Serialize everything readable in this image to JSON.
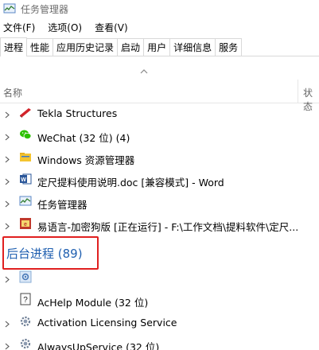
{
  "window": {
    "title": "任务管理器",
    "app_icon": "task-manager-icon"
  },
  "menu": [
    {
      "label": "文件(F)"
    },
    {
      "label": "选项(O)"
    },
    {
      "label": "查看(V)"
    }
  ],
  "tabs": [
    {
      "label": "进程",
      "active": true
    },
    {
      "label": "性能"
    },
    {
      "label": "应用历史记录"
    },
    {
      "label": "启动"
    },
    {
      "label": "用户"
    },
    {
      "label": "详细信息"
    },
    {
      "label": "服务"
    }
  ],
  "columns": {
    "name": "名称",
    "status": "状态"
  },
  "apps": [
    {
      "label": "Tekla Structures",
      "icon": "tekla-icon"
    },
    {
      "label": "WeChat (32 位) (4)",
      "icon": "wechat-icon"
    },
    {
      "label": "Windows 资源管理器",
      "icon": "folder-icon"
    },
    {
      "label": "定尺提料使用说明.doc [兼容模式] - Word",
      "icon": "word-icon"
    },
    {
      "label": "任务管理器",
      "icon": "task-manager-icon"
    },
    {
      "label": "易语言-加密狗版 [正在运行] - F:\\工作文档\\提料软件\\定尺...",
      "icon": "e-language-icon"
    }
  ],
  "background_section": {
    "title": "后台进程 (89)"
  },
  "background": [
    {
      "label": "",
      "icon": "gear-icon",
      "has_chevron": true
    },
    {
      "label": "AcHelp Module (32 位)",
      "icon": "help-icon",
      "has_chevron": false
    },
    {
      "label": "Activation Licensing Service",
      "icon": "service-icon",
      "has_chevron": true
    },
    {
      "label": "AlwaysUpService (32 位)",
      "icon": "service-icon",
      "has_chevron": true
    }
  ],
  "colors": {
    "section_title": "#1f5fb0",
    "highlight": "#e02020"
  }
}
